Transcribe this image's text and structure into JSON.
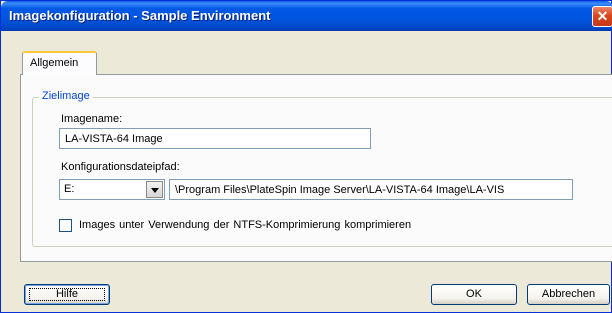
{
  "window": {
    "title": "Imagekonfiguration - Sample Environment",
    "close_glyph": "✕"
  },
  "tabs": [
    {
      "label": "Allgemein",
      "selected": true
    }
  ],
  "group": {
    "legend": "Zielimage",
    "image_name_label": "Imagename:",
    "image_name_value": "LA-VISTA-64 Image",
    "config_path_label": "Konfigurationsdateipfad:",
    "drive_value": "E:",
    "path_value": "\\Program Files\\PlateSpin Image Server\\LA-VISTA-64 Image\\LA-VIS",
    "compress_label": "Images  unter  Verwendung  der  NTFS-Komprimierung  komprimieren",
    "compress_checked": false
  },
  "buttons": {
    "help": "Hilfe",
    "ok": "OK",
    "cancel": "Abbrechen"
  },
  "colors": {
    "titlebar": "#0055dd",
    "dialog_bg": "#ece9d8",
    "group_legend": "#0046d5",
    "tab_accent": "#ffc83c"
  }
}
